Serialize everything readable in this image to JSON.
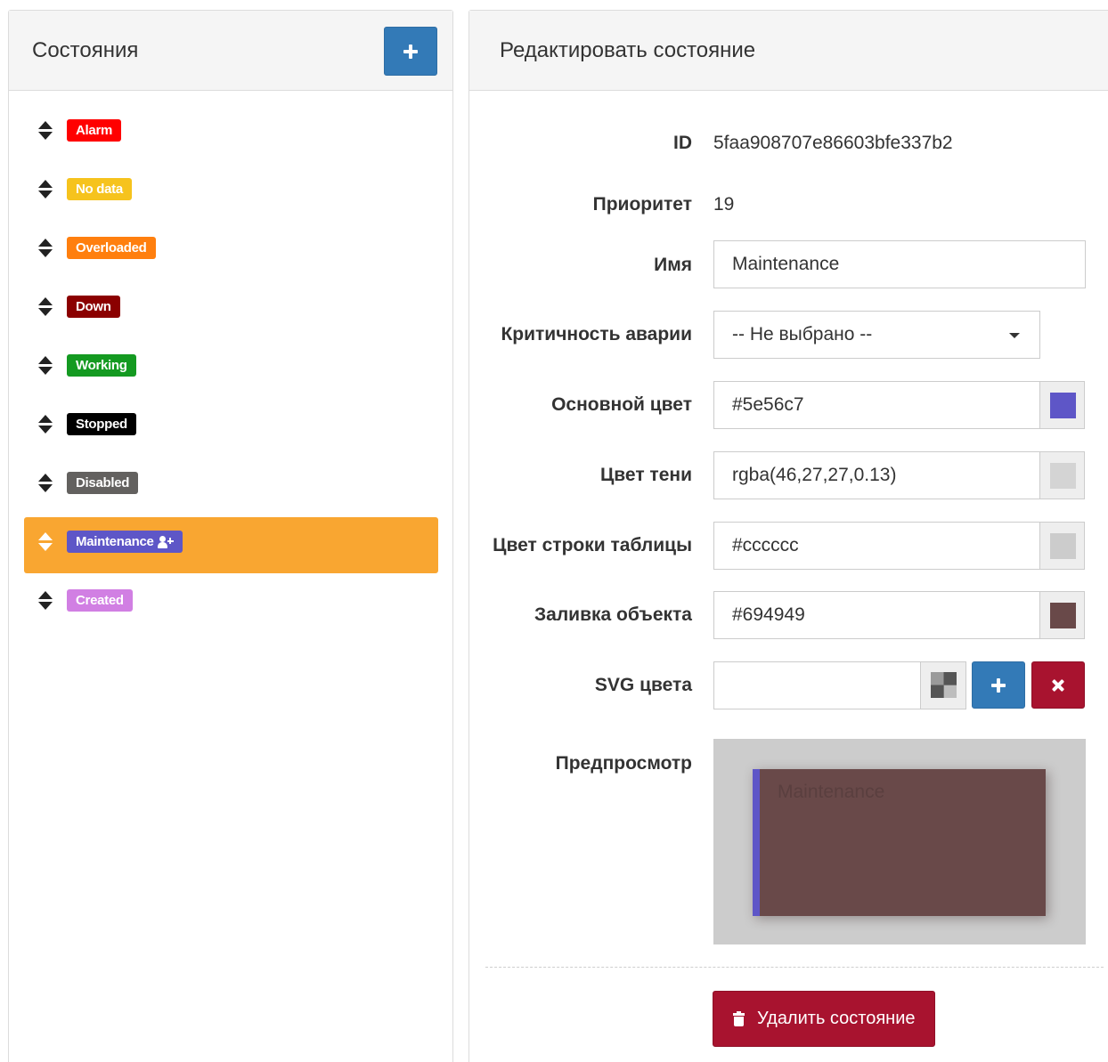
{
  "left_panel": {
    "title": "Состояния",
    "add_icon": "plus-icon",
    "states": [
      {
        "label": "Alarm",
        "color": "#ff0000",
        "active": false
      },
      {
        "label": "No data",
        "color": "#f6c31d",
        "active": false
      },
      {
        "label": "Overloaded",
        "color": "#ff7f0e",
        "active": false
      },
      {
        "label": "Down",
        "color": "#8b0000",
        "active": false
      },
      {
        "label": "Working",
        "color": "#149a21",
        "active": false
      },
      {
        "label": "Stopped",
        "color": "#000000",
        "active": false
      },
      {
        "label": "Disabled",
        "color": "#63615f",
        "active": false
      },
      {
        "label": "Maintenance",
        "color": "#5e56c7",
        "active": true,
        "icon": "user-plus-icon"
      },
      {
        "label": "Created",
        "color": "#d17fe3",
        "active": false
      }
    ],
    "active_row_color": "#f9a631"
  },
  "right_panel": {
    "title": "Редактировать состояние",
    "id": {
      "label": "ID",
      "value": "5faa908707e86603bfe337b2"
    },
    "priority": {
      "label": "Приоритет",
      "value": "19"
    },
    "name": {
      "label": "Имя",
      "value": "Maintenance"
    },
    "criticality": {
      "label": "Критичность аварии",
      "value": "-- Не выбрано --"
    },
    "main_color": {
      "label": "Основной цвет",
      "value": "#5e56c7",
      "swatch": "#5e56c7"
    },
    "shadow_color": {
      "label": "Цвет тени",
      "value": "rgba(46,27,27,0.13)",
      "swatch": "#d4d4d4"
    },
    "row_color": {
      "label": "Цвет строки таблицы",
      "value": "#cccccc",
      "swatch": "#cccccc"
    },
    "fill_color": {
      "label": "Заливка объекта",
      "value": "#694949",
      "swatch": "#694949"
    },
    "svg_colors": {
      "label": "SVG цвета",
      "value": ""
    },
    "preview": {
      "label": "Предпросмотр",
      "text": "Maintenance"
    },
    "delete_button": "Удалить состояние"
  }
}
